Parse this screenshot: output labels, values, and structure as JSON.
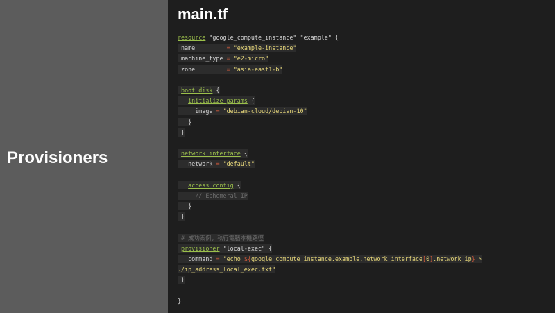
{
  "slide": {
    "section_title": "Provisioners",
    "file_title": "main.tf"
  },
  "code": {
    "l01": {
      "kw": "resource",
      "s1": "\"google_compute_instance\"",
      "s2": "\"example\"",
      "brace": "{"
    },
    "l02": {
      "key": "name",
      "eq": "=",
      "val": "\"example-instance\""
    },
    "l03": {
      "key": "machine_type",
      "eq": "=",
      "val": "\"e2-micro\""
    },
    "l04": {
      "key": "zone",
      "eq": "=",
      "val": "\"asia-east1-b\""
    },
    "l06": {
      "kw": "boot_disk",
      "brace": "{"
    },
    "l07": {
      "kw": "initialize_params",
      "brace": "{"
    },
    "l08": {
      "key": "image",
      "eq": "=",
      "val": "\"debian-cloud/debian-10\""
    },
    "l09": {
      "brace": "}"
    },
    "l10": {
      "brace": "}"
    },
    "l12": {
      "kw": "network_interface",
      "brace": "{"
    },
    "l13": {
      "key": "network",
      "eq": "=",
      "val": "\"default\""
    },
    "l15": {
      "kw": "access_config",
      "brace": "{"
    },
    "l16": {
      "comment": "// Ephemeral IP"
    },
    "l17": {
      "brace": "}"
    },
    "l18": {
      "brace": "}"
    },
    "l20": {
      "comment": "# 成功案例，執行電腦本機路徑"
    },
    "l21": {
      "kw": "provisioner",
      "s1": "\"local-exec\"",
      "brace": "{"
    },
    "l22": {
      "key": "command",
      "eq": "=",
      "s1": "\"echo",
      "interp_open": "${",
      "expr": "google_compute_instance.example.network_interface",
      "idx_open": "[",
      "idx": "0",
      "idx_close": "]",
      "tail": ".network_ip",
      "interp_close": "}",
      "gt": ">"
    },
    "l23": {
      "val": "./ip_address_local_exec.txt\""
    },
    "l24": {
      "brace": "}"
    },
    "l26": {
      "brace": "}"
    }
  }
}
